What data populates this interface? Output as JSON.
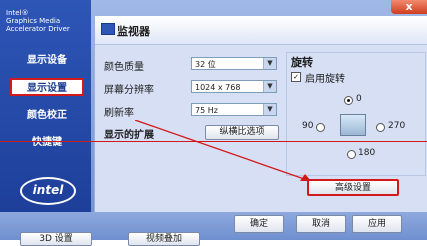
{
  "window": {
    "brand_line1": "Intel®",
    "brand_line2": "Graphics Media",
    "brand_line3": "Accelerator Driver",
    "close_label": "x"
  },
  "sidebar": {
    "items": [
      {
        "label": "显示设备"
      },
      {
        "label": "显示设置"
      },
      {
        "label": "颜色校正"
      },
      {
        "label": "快捷键"
      }
    ],
    "logo_text": "intel"
  },
  "panel": {
    "title": "监视器",
    "color_quality_label": "颜色质量",
    "color_quality_value": "32 位",
    "resolution_label": "屏幕分辨率",
    "resolution_value": "1024 x 768",
    "refresh_label": "刷新率",
    "refresh_value": "75 Hz",
    "extension_label": "显示的扩展",
    "aspect_button": "纵横比选项"
  },
  "rotation": {
    "title": "旋转",
    "enable_label": "启用旋转",
    "r0": "0",
    "r90": "90",
    "r270": "270",
    "r180": "180",
    "advanced_button": "高级设置"
  },
  "footer": {
    "ok": "确定",
    "cancel": "取消",
    "apply": "应用",
    "btn_3d": "3D 设置",
    "btn_video": "视频叠加"
  },
  "colors": {
    "sidebar": "#2e56b7",
    "highlight": "#d21a1a",
    "panel_bg": "#d6dff4"
  }
}
